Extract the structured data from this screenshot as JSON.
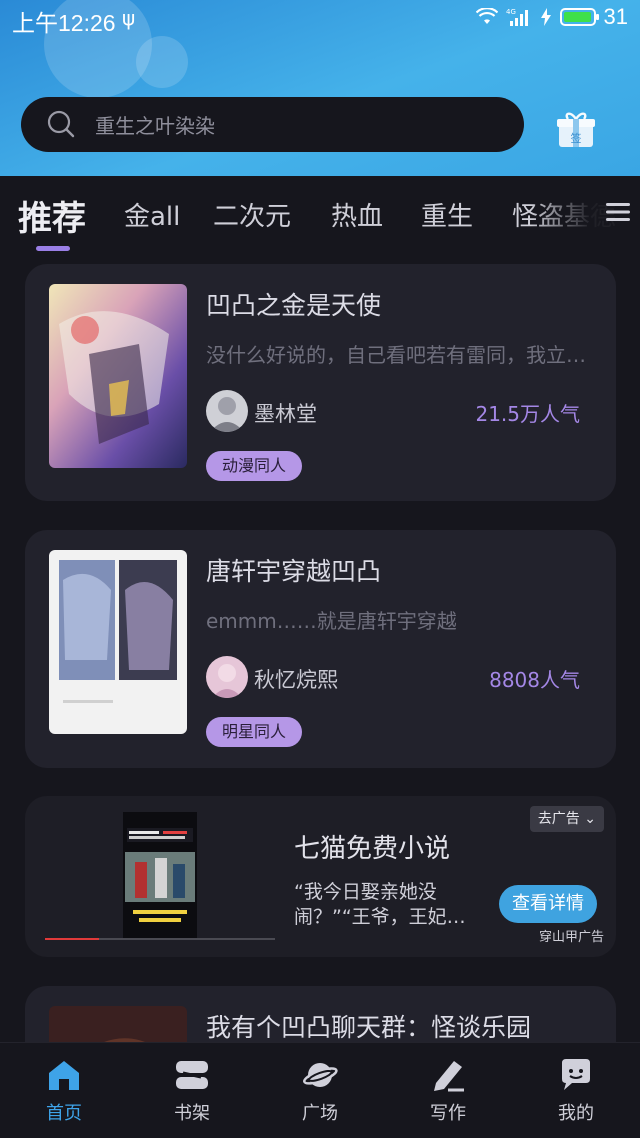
{
  "status_bar": {
    "time": "上午12:26",
    "battery": "31"
  },
  "search": {
    "placeholder": "重生之叶染染"
  },
  "tabs": [
    "推荐",
    "金all",
    "二次元",
    "热血",
    "重生",
    "怪盗基德"
  ],
  "feed": [
    {
      "title": "凹凸之金是天使",
      "desc": "没什么好说的，自己看吧若有雷同，我立即删除",
      "author": "墨林堂",
      "popularity": "21.5万人气",
      "tag": "动漫同人"
    },
    {
      "title": "唐轩宇穿越凹凸",
      "desc": "emmm……就是唐轩宇穿越",
      "author": "秋忆烷熙",
      "popularity": "8808人气",
      "tag": "明星同人"
    }
  ],
  "ad": {
    "close_label": "去广告",
    "title": "七猫免费小说",
    "desc": "“我今日娶亲她没闹？”“王爷，王妃…",
    "button": "查看详情",
    "source": "穿山甲广告"
  },
  "partial_card": {
    "title": "我有个凹凸聊天群：怪谈乐园"
  },
  "bottom_nav": [
    {
      "label": "首页",
      "icon": "home-icon"
    },
    {
      "label": "书架",
      "icon": "bookshelf-icon"
    },
    {
      "label": "广场",
      "icon": "planet-icon"
    },
    {
      "label": "写作",
      "icon": "pen-icon"
    },
    {
      "label": "我的",
      "icon": "chat-bubble-icon"
    }
  ],
  "colors": {
    "accent": "#3ea3e8",
    "tag_bg": "#b597e7",
    "popularity": "#a487e6",
    "card_bg": "#22222c",
    "page_bg": "#16161d"
  }
}
